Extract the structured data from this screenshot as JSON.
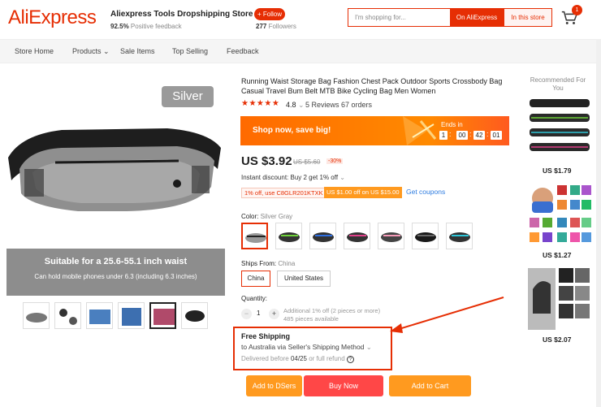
{
  "header": {
    "logo": "AliExpress",
    "store_name": "Aliexpress Tools Dropshipping Store",
    "positive_pct": "92.5%",
    "positive_label": "Positive feedback",
    "follow_label": "+ Follow",
    "followers_count": "277",
    "followers_label": "Followers",
    "search_placeholder": "I'm shopping for...",
    "search_on_ali": "On AliExpress",
    "search_in_store": "In this store",
    "cart_count": "1"
  },
  "nav": {
    "items": [
      "Store Home",
      "Products",
      "Sale Items",
      "Top Selling",
      "Feedback"
    ]
  },
  "gallery": {
    "color_label": "Silver",
    "banner_title": "Suitable for a 25.6-55.1 inch waist",
    "banner_subtitle": "Can hold mobile phones under 6.3 (including 6.3 inches)"
  },
  "product": {
    "title": "Running Waist Storage Bag Fashion Chest Pack Outdoor Sports Crossbody Bag Casual Travel Bum Belt MTB Bike Cycling Bag Men Women",
    "stars": "★★★★★",
    "rating": "4.8",
    "reviews": "5 Reviews",
    "orders": "67 orders",
    "promo_text": "Shop now, save big!",
    "ends_in_label": "Ends in",
    "countdown": [
      "1",
      "00",
      "42",
      "01"
    ],
    "price": "US $3.92",
    "old_price": "US $5.60",
    "discount": "-30%",
    "instant_discount": "Instant discount: Buy 2 get 1% off",
    "coupon1": "1% off, use C8GLR201KTXK",
    "coupon2": "US $1.00 off on US $15.00",
    "get_coupons": "Get coupons",
    "color_label": "Color:",
    "color_value": "Silver Gray",
    "ships_from_label": "Ships From:",
    "ships_from_value": "China",
    "ship_options": [
      "China",
      "United States"
    ],
    "quantity_label": "Quantity:",
    "quantity": "1",
    "qty_note1": "Additional 1% off (2 pieces or more)",
    "qty_note2": "485 pieces available",
    "free_shipping": "Free Shipping",
    "ship_to": "to Australia via Seller's Shipping Method",
    "delivered_prefix": "Delivered before",
    "delivered_date": "04/25",
    "delivered_suffix": "or full refund",
    "btn_dsers": "Add to DSers",
    "btn_buy": "Buy Now",
    "btn_cart": "Add to Cart"
  },
  "recommended": {
    "title": "Recommended For You",
    "prices": [
      "US $1.79",
      "US $1.27",
      "US $2.07"
    ]
  },
  "colors": {
    "accent": "#e62e04",
    "promo": "#ff6a00",
    "buy": "#ff4747",
    "cart": "#ff9a1f",
    "link": "#2e7ce0"
  }
}
